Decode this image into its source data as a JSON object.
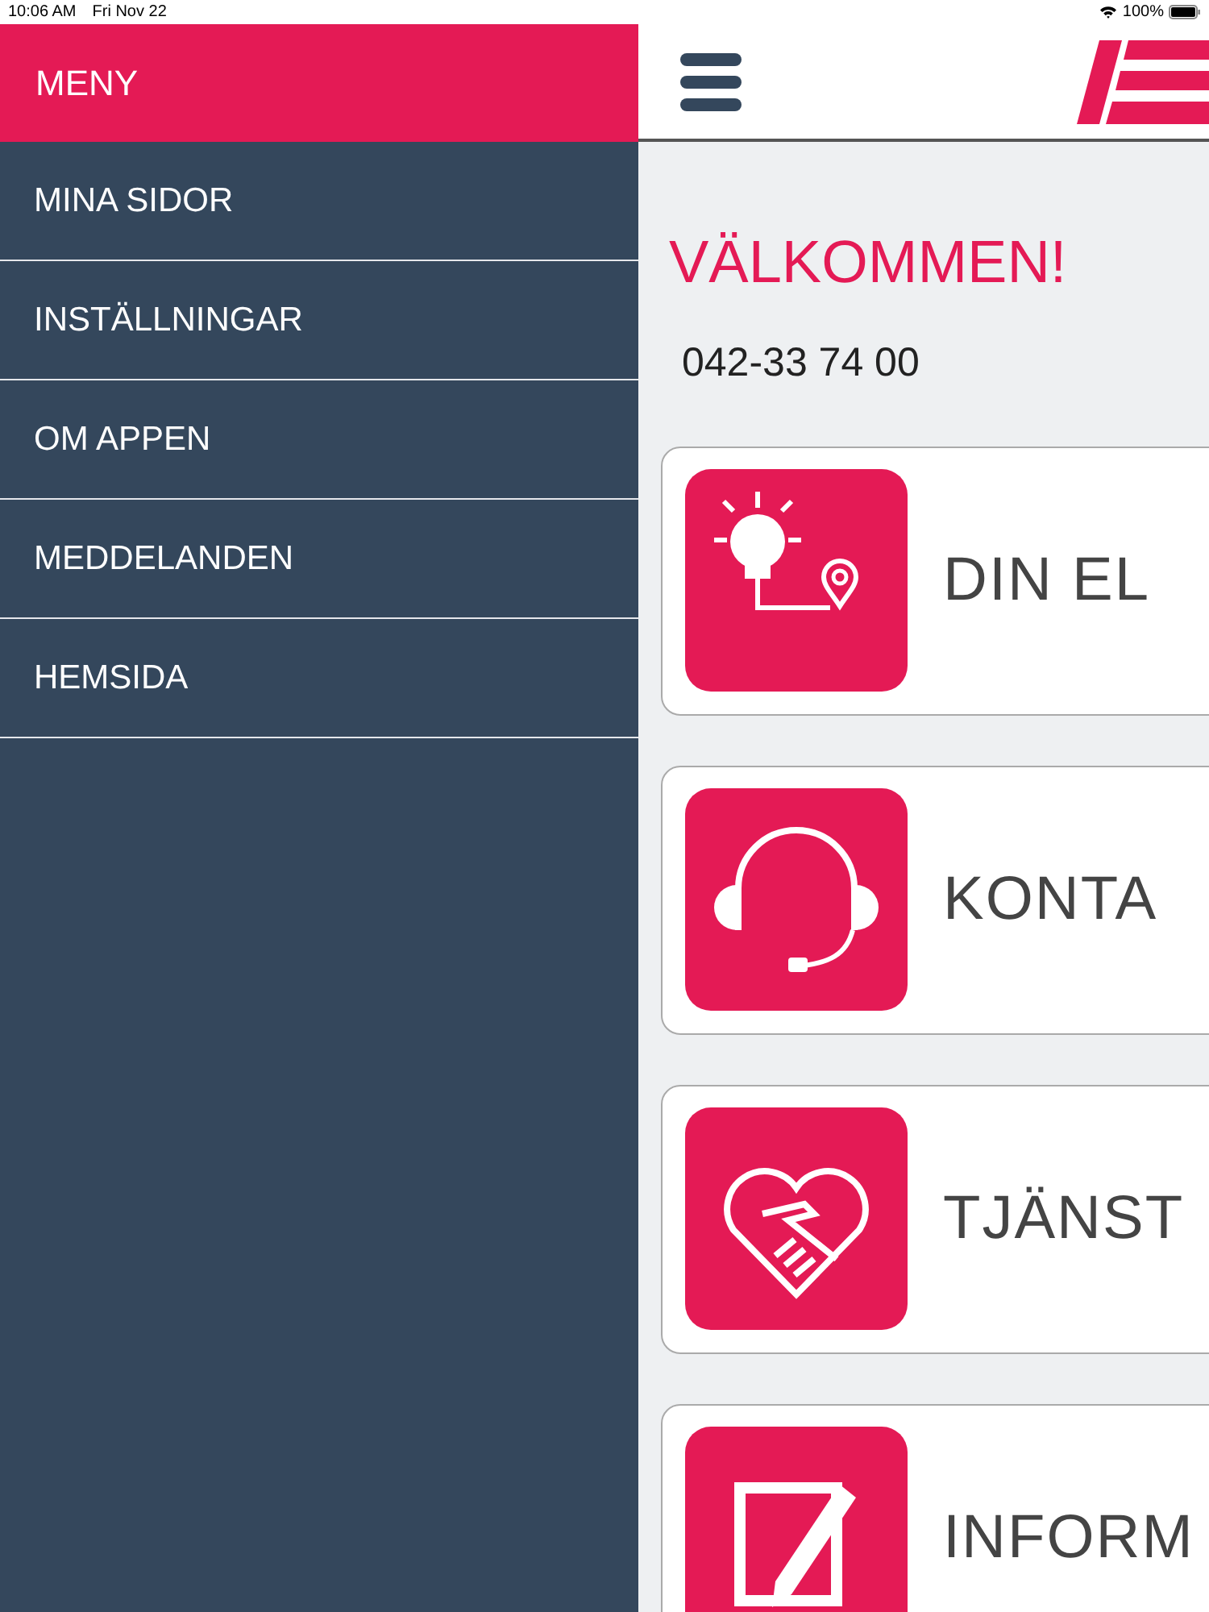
{
  "status_bar": {
    "time": "10:06 AM",
    "date": "Fri Nov 22",
    "battery": "100%"
  },
  "sidebar": {
    "title": "MENY",
    "items": [
      {
        "label": "MINA SIDOR"
      },
      {
        "label": "INSTÄLLNINGAR"
      },
      {
        "label": "OM APPEN"
      },
      {
        "label": "MEDDELANDEN"
      },
      {
        "label": "HEMSIDA"
      }
    ]
  },
  "main": {
    "heading": "VÄLKOMMEN!",
    "phone": "042-33 74 00",
    "tiles": [
      {
        "kind": "bulb",
        "label": "DIN EL"
      },
      {
        "kind": "headset",
        "label": "KONTA"
      },
      {
        "kind": "handshake",
        "label": "TJÄNST"
      },
      {
        "kind": "edit",
        "label": "INFORM"
      }
    ]
  }
}
